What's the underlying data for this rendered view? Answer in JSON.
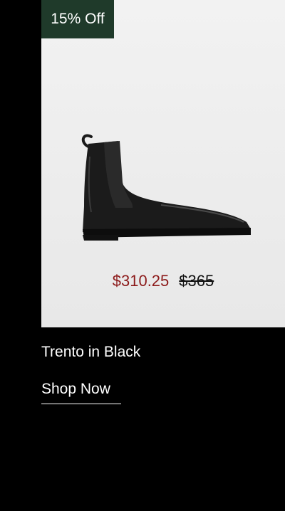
{
  "badge": {
    "label": "15% Off"
  },
  "product": {
    "image_icon": "chelsea-boot",
    "sale_price": "$310.25",
    "original_price": "$365",
    "title": "Trento in Black"
  },
  "cta": {
    "label": "Shop Now"
  },
  "colors": {
    "background": "#000000",
    "badge_bg": "#1f3a2a",
    "sale_price": "#8c1a1a",
    "card_bg": "#ededed"
  }
}
